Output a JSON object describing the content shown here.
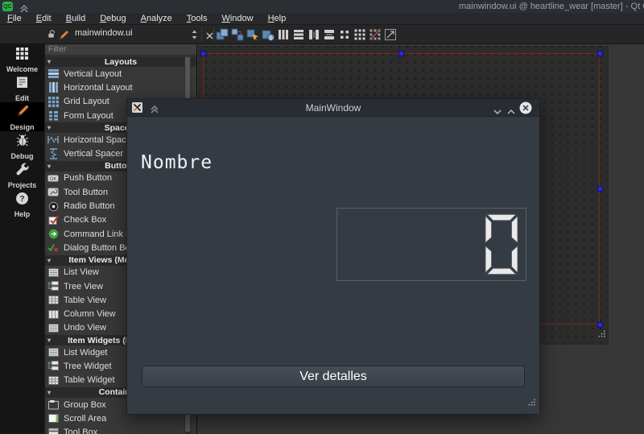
{
  "titlebar": {
    "app_icon": "qtcreator-badge",
    "app_badge": "QC",
    "collapse_icon": "double-chevron-up-icon",
    "title": "mainwindow.ui @ heartline_wear [master] - Qt Cre"
  },
  "menubar": {
    "items": [
      "File",
      "Edit",
      "Build",
      "Debug",
      "Analyze",
      "Tools",
      "Window",
      "Help"
    ]
  },
  "toolbar": {
    "lock_icon": "open-lock-icon",
    "edit_icon": "pencil-icon",
    "document_name": "mainwindow.ui",
    "spinner_icon": "up-down-arrows-icon",
    "close_icon": "close-x-icon",
    "action_icons": [
      "edit-widgets-icon",
      "edit-signals-slots-icon",
      "edit-buddies-icon",
      "edit-tab-order-icon",
      "layout-horizontal-icon",
      "layout-vertical-icon",
      "layout-horizontal-splitter-icon",
      "layout-vertical-splitter-icon",
      "layout-form-icon",
      "layout-grid-icon",
      "break-layout-icon",
      "adjust-size-icon"
    ]
  },
  "modebar": {
    "items": [
      {
        "label": "Welcome",
        "icon": "welcome-grid-icon",
        "active": false
      },
      {
        "label": "Edit",
        "icon": "edit-document-icon",
        "active": false
      },
      {
        "label": "Design",
        "icon": "design-pencil-icon",
        "active": true
      },
      {
        "label": "Debug",
        "icon": "debug-bug-icon",
        "active": false
      },
      {
        "label": "Projects",
        "icon": "projects-wrench-icon",
        "active": false
      },
      {
        "label": "Help",
        "icon": "help-circle-icon",
        "active": false
      }
    ]
  },
  "widgetbox": {
    "filter_placeholder": "Filter",
    "sections": [
      {
        "header": "Layouts",
        "items": [
          {
            "label": "Vertical Layout",
            "icon": "vertical-layout-icon"
          },
          {
            "label": "Horizontal Layout",
            "icon": "horizontal-layout-icon"
          },
          {
            "label": "Grid Layout",
            "icon": "grid-layout-icon"
          },
          {
            "label": "Form Layout",
            "icon": "form-layout-icon"
          }
        ]
      },
      {
        "header": "Spacers",
        "items": [
          {
            "label": "Horizontal Spacer",
            "icon": "horizontal-spacer-icon"
          },
          {
            "label": "Vertical Spacer",
            "icon": "vertical-spacer-icon"
          }
        ]
      },
      {
        "header": "Buttons",
        "items": [
          {
            "label": "Push Button",
            "icon": "push-button-icon"
          },
          {
            "label": "Tool Button",
            "icon": "tool-button-icon"
          },
          {
            "label": "Radio Button",
            "icon": "radio-button-icon"
          },
          {
            "label": "Check Box",
            "icon": "check-box-icon"
          },
          {
            "label": "Command Link Button",
            "icon": "command-link-button-icon"
          },
          {
            "label": "Dialog Button Box",
            "icon": "dialog-button-box-icon"
          }
        ]
      },
      {
        "header": "Item Views (Model-Based)",
        "items": [
          {
            "label": "List View",
            "icon": "list-view-icon"
          },
          {
            "label": "Tree View",
            "icon": "tree-view-icon"
          },
          {
            "label": "Table View",
            "icon": "table-view-icon"
          },
          {
            "label": "Column View",
            "icon": "column-view-icon"
          },
          {
            "label": "Undo View",
            "icon": "undo-view-icon"
          }
        ]
      },
      {
        "header": "Item Widgets (Item-Based)",
        "items": [
          {
            "label": "List Widget",
            "icon": "list-widget-icon"
          },
          {
            "label": "Tree Widget",
            "icon": "tree-widget-icon"
          },
          {
            "label": "Table Widget",
            "icon": "table-widget-icon"
          }
        ]
      },
      {
        "header": "Containers",
        "items": [
          {
            "label": "Group Box",
            "icon": "group-box-icon"
          },
          {
            "label": "Scroll Area",
            "icon": "scroll-area-icon"
          },
          {
            "label": "Tool Box",
            "icon": "tool-box-icon"
          }
        ]
      }
    ]
  },
  "canvas": {
    "selection_color": "#8c1d1d",
    "handle_color": "#2b2bd6"
  },
  "preview_window": {
    "window_icon": "preview-window-icon",
    "collapse_icon": "double-chevron-up-icon",
    "title": "MainWindow",
    "minimize_icon": "chevron-down-icon",
    "maximize_icon": "chevron-up-icon",
    "close_icon": "close-circle-icon",
    "name_label": "Nombre",
    "lcd_value": "0",
    "details_button_label": "Ver detalles"
  },
  "colors": {
    "qt_green": "#2fae4a",
    "selection_red": "#8c1d1d",
    "handle_blue": "#2b2bd6",
    "accent_orange": "#e0813a"
  }
}
